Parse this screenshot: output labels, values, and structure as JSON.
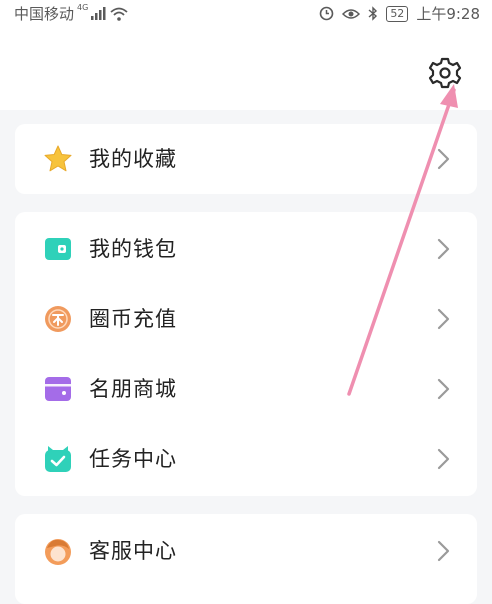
{
  "status_bar": {
    "carrier": "中国移动",
    "network": "4G",
    "battery": "52",
    "time": "上午9:28"
  },
  "header": {
    "settings_icon": "gear-icon"
  },
  "sections": [
    {
      "items": [
        {
          "label": "我的收藏",
          "icon": "star-icon"
        }
      ]
    },
    {
      "items": [
        {
          "label": "我的钱包",
          "icon": "wallet-icon"
        },
        {
          "label": "圈币充值",
          "icon": "coin-icon"
        },
        {
          "label": "名朋商城",
          "icon": "shop-icon"
        },
        {
          "label": "任务中心",
          "icon": "task-icon"
        }
      ]
    },
    {
      "items": [
        {
          "label": "客服中心",
          "icon": "customer-service-icon"
        }
      ]
    }
  ],
  "annotation": {
    "color": "#ef8fb0",
    "points_to": "gear-icon"
  },
  "colors": {
    "star": "#f7c33c",
    "wallet": "#2fd1b9",
    "coin": "#f09a5e",
    "shop": "#a46ce8",
    "task": "#2fd1b9",
    "service": "#f39c5a"
  }
}
